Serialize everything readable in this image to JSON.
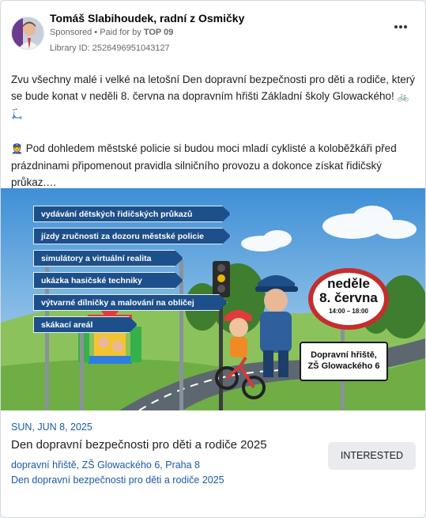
{
  "post": {
    "author": "Tomáš Slabihoudek, radní z Osmičky",
    "sponsored": "Sponsored",
    "paid_prefix": "Paid for by",
    "paid_by": "TOP 09",
    "library_id": "Library ID: 2526496951043127",
    "text_p1": "Zvu všechny malé i velké na letošní Den dopravní bezpečnosti pro děti a rodiče, který se bude konat v neděli 8. června na dopravním hřišti Základní školy Glowackého!",
    "text_p1_emoji": "🚲 🛴",
    "text_p2_emoji": "👮",
    "text_p2": "Pod dohledem městské policie si budou moci mladí cyklisté a koloběžkáři před prázdninami připomenout pravidla silničního provozu a dokonce získat řidičský průkaz.…"
  },
  "banner": {
    "signs": [
      "vydávání dětských řidičských průkazů",
      "jízdy zručnosti za dozoru městské policie",
      "simulátory a virtuální realita",
      "ukázka hasičské techniky",
      "výtvarné dílničky a malování na obličej",
      "skákací areál"
    ],
    "date_line1": "neděle",
    "date_line2": "8. června",
    "time": "14:00 – 18:00",
    "place_line1": "Dopravní hřiště,",
    "place_line2": "ZŠ Glowackého 6"
  },
  "event": {
    "date": "SUN, JUN 8, 2025",
    "title": "Den dopravní bezpečnosti pro děti a rodiče 2025",
    "location": "dopravní hřiště, ZŠ Glowackého 6, Praha 8",
    "subtitle": "Den dopravní bezpečnosti pro děti a rodiče 2025",
    "interested_label": "INTERESTED"
  }
}
